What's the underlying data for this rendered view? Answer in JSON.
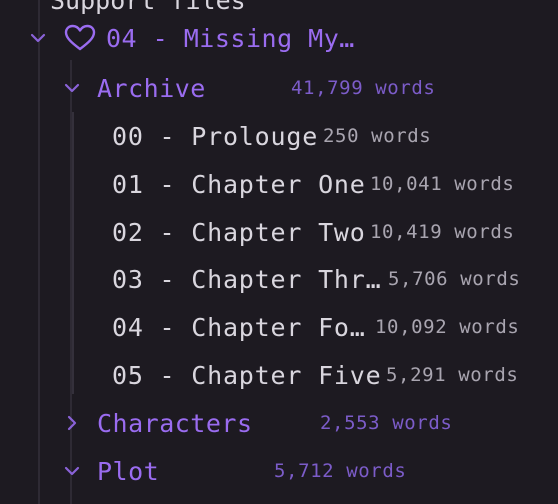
{
  "tree": {
    "top_clipped_text": "Support files",
    "project": {
      "label": "04 - Missing My…",
      "icon": "heart-icon",
      "expanded": true
    },
    "archive": {
      "label": "Archive",
      "count": "41,799 words",
      "expanded": true,
      "documents": [
        {
          "label": "00 - Prolouge",
          "count": "250 words"
        },
        {
          "label": "01 - Chapter One",
          "count": "10,041 words"
        },
        {
          "label": "02 - Chapter Two",
          "count": "10,419 words"
        },
        {
          "label": "03 - Chapter Thr…",
          "count": "5,706 words"
        },
        {
          "label": "04 - Chapter Fo…",
          "count": "10,092 words"
        },
        {
          "label": "05 - Chapter Five",
          "count": "5,291 words"
        }
      ]
    },
    "characters": {
      "label": "Characters",
      "count": "2,553 words",
      "expanded": false
    },
    "plot": {
      "label": "Plot",
      "count": "5,712 words",
      "expanded": true
    }
  },
  "colors": {
    "background": "#1d1a21",
    "accent_purple": "#9a6cf0",
    "count_purple": "#7c5cc9",
    "document_text": "#d9d6de",
    "document_count": "#a9a5b0"
  }
}
